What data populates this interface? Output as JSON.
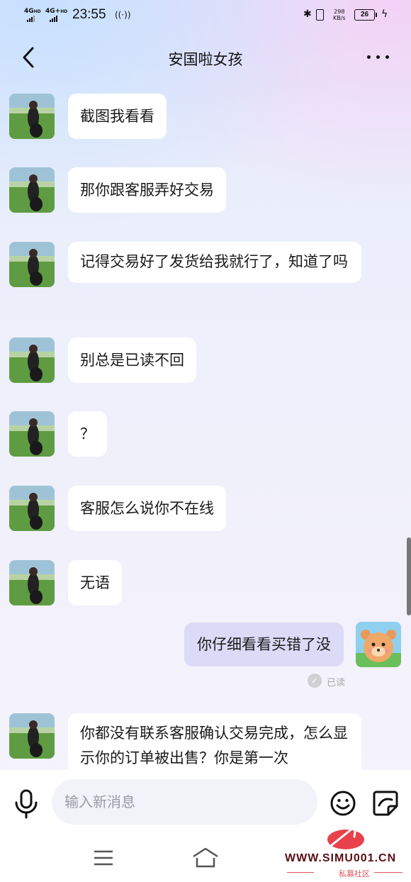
{
  "status_bar": {
    "sig1_top": "4G",
    "sig1_sup": "HD",
    "sig2_top": "4G+",
    "sig2_sup": "HD",
    "time": "23:55",
    "net_speed_value": "298",
    "net_speed_unit": "KB/s",
    "battery": "26"
  },
  "header": {
    "title": "安国啦女孩"
  },
  "messages": [
    {
      "side": "left",
      "text": "截图我看看"
    },
    {
      "side": "left",
      "text": "那你跟客服弄好交易"
    },
    {
      "side": "left",
      "text": "记得交易好了发货给我就行了，知道了吗"
    },
    {
      "side": "left",
      "text": "别总是已读不回"
    },
    {
      "side": "left",
      "text": "？"
    },
    {
      "side": "left",
      "text": "客服怎么说你不在线"
    },
    {
      "side": "left",
      "text": "无语"
    },
    {
      "side": "right",
      "text": "你仔细看看买错了没",
      "status": "已读"
    },
    {
      "side": "left",
      "text": "你都没有联系客服确认交易完成，怎么显示你的订单被出售？你是第一次"
    }
  ],
  "input": {
    "placeholder": "输入新消息"
  },
  "watermark": {
    "text": "WWW.SIMU001.CN",
    "sub": "私募社区"
  },
  "colors": {
    "outgoing_bubble": "#dcdaf6",
    "incoming_bubble": "#ffffff",
    "accent": "#1a1a1a"
  },
  "icons": [
    "back-arrow-icon",
    "more-icon",
    "mic-icon",
    "emoji-icon",
    "sticker-icon",
    "menu-icon",
    "home-icon",
    "read-check-icon"
  ]
}
